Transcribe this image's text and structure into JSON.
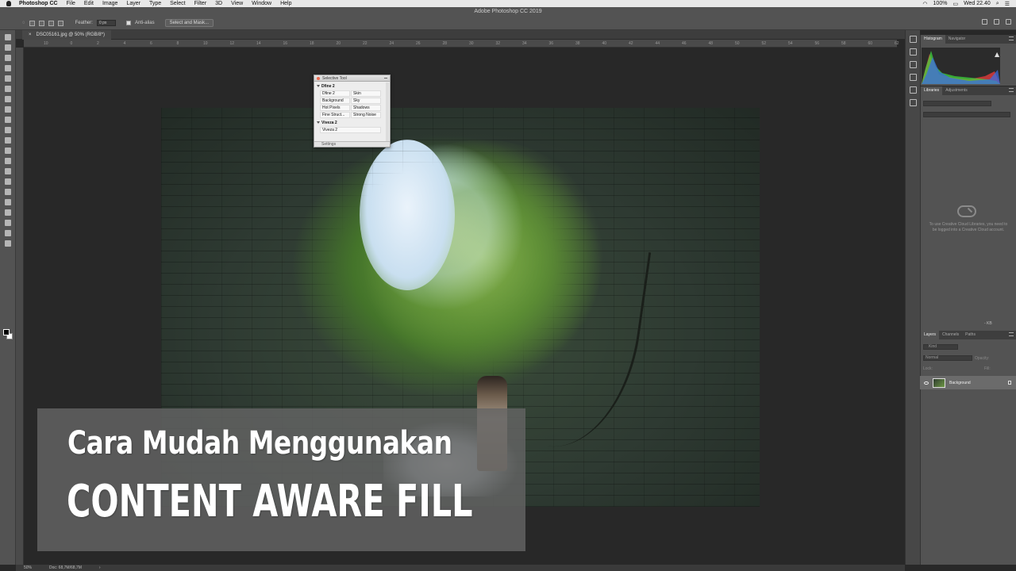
{
  "menubar": {
    "app": "Photoshop CC",
    "items": [
      "File",
      "Edit",
      "Image",
      "Layer",
      "Type",
      "Select",
      "Filter",
      "3D",
      "View",
      "Window",
      "Help"
    ],
    "battery": "100%",
    "clock": "Wed 22.40"
  },
  "window": {
    "title": "Adobe Photoshop CC 2019"
  },
  "options": {
    "feather_label": "Feather:",
    "feather_value": "0 px",
    "antialias_label": "Anti-alias",
    "select_mask_button": "Select and Mask..."
  },
  "document": {
    "tab_title": "DSC05161.jpg @ 50% (RGB/8*)"
  },
  "ruler_ticks": [
    "10",
    "0",
    "2",
    "4",
    "6",
    "8",
    "10",
    "12",
    "14",
    "16",
    "18",
    "20",
    "22",
    "24",
    "26",
    "28",
    "30",
    "32",
    "34",
    "36",
    "38",
    "40",
    "42",
    "44",
    "46",
    "48",
    "50",
    "52",
    "54",
    "56",
    "58",
    "60",
    "62"
  ],
  "dialog": {
    "title": "Selective Tool",
    "section1": "Dfine 2",
    "cells": [
      "Dfine 2",
      "Skin",
      "Background",
      "Sky",
      "Hot Pixels",
      "Shadows",
      "Fine Struct...",
      "Strong Noise"
    ],
    "section2": "Viveza 2",
    "cell_viveza": "Viveza 2",
    "footer": "Settings"
  },
  "panels": {
    "histogram_tabs": [
      "Histogram",
      "Navigator"
    ],
    "libraries_tabs": [
      "Libraries",
      "Adjustments"
    ],
    "libraries_message": "To use Creative Cloud Libraries, you need to be logged into a Creative Cloud account.",
    "kb_label": "- KB",
    "layers_tabs": [
      "Layers",
      "Channels",
      "Paths"
    ],
    "kind_label": "Kind",
    "blend_mode": "Normal",
    "opacity_label": "Opacity:",
    "lock_label": "Lock:",
    "fill_label": "Fill:",
    "layer_name": "Background"
  },
  "status": {
    "zoom": "50%",
    "doc_size": "Doc: 68,7M/68,7M"
  },
  "overlay": {
    "line1": "Cara Mudah Menggunakan",
    "line2": "CONTENT AWARE FILL"
  },
  "colors": {
    "ui_dark": "#282828",
    "ui_mid": "#535353",
    "overlay": "#646464"
  }
}
